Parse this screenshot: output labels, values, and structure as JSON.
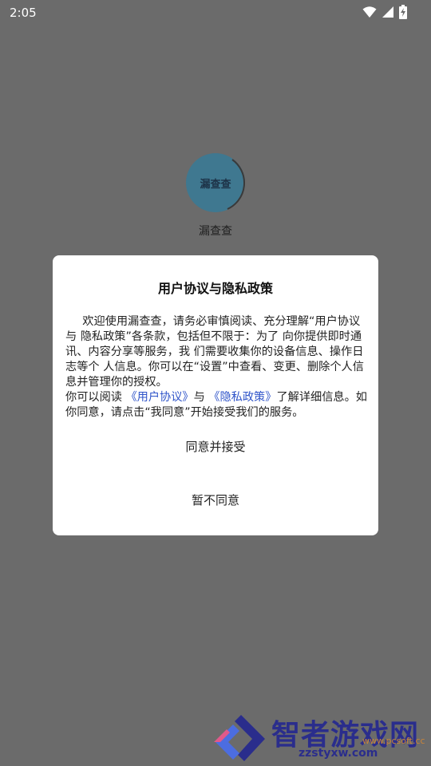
{
  "status_bar": {
    "time": "2:05"
  },
  "splash": {
    "logo_text": "漏查查",
    "app_name": "漏查查"
  },
  "dialog": {
    "title": "用户协议与隐私政策",
    "paragraph1": "欢迎使用漏查查，请务必审慎阅读、充分理解“用户协议与 隐私政策”各条款，包括但不限于：为了 向你提供即时通讯、内容分享等服务，我 们需要收集你的设备信息、操作日志等个 人信息。你可以在“设置”中查看、变更、删除个人信息并管理你的授权。",
    "paragraph2_prefix": "你可以阅读 ",
    "link_user_agreement": "《用户协议》",
    "paragraph2_mid": "与 ",
    "link_privacy_policy": "《隐私政策》",
    "paragraph2_suffix": "了解详细信息。如你同意，请点击“我同意”开始接受我们的服务。",
    "agree_label": "同意并接受",
    "disagree_label": "暂不同意"
  },
  "watermark": {
    "main": "智者游戏网",
    "sub": "zzstyxw.com",
    "sub2": "www.pcsoft.cc"
  },
  "colors": {
    "overlay": "#6b6b6b",
    "link": "#2f54c9",
    "logo": "#3f7890",
    "watermark": "#2a2d8c"
  }
}
